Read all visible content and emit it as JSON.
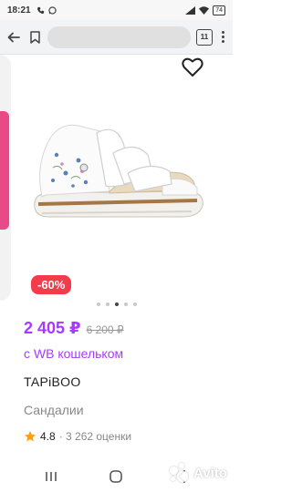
{
  "status_bar": {
    "time": "18:21",
    "battery": "74",
    "icons": [
      "phone-icon",
      "whatsapp-icon",
      "signal-icon",
      "wifi-icon",
      "battery-icon"
    ]
  },
  "browser": {
    "tabs_count": "11",
    "icons": [
      "back-arrow-icon",
      "bookmark-icon",
      "tabs-icon",
      "more-vertical-icon"
    ]
  },
  "product": {
    "discount": "-60%",
    "price": "2 405 ₽",
    "old_price": "6 200 ₽",
    "wallet_text": "с WB кошельком",
    "brand": "TAPiBOO",
    "name": "Сандалии",
    "rating": "4.8",
    "reviews": "· 3 262 оценки",
    "gallery_dots_total": 5,
    "gallery_dots_active": 3,
    "gallery_icons": [
      "heart-icon",
      "star-icon"
    ]
  },
  "watermark": {
    "text": "Avito"
  },
  "nav_bar": {
    "icons": [
      "recent-apps-icon",
      "home-icon",
      "back-icon"
    ]
  },
  "colors": {
    "accent": "#a73afd",
    "discount": "#f23b4b",
    "star": "#ff9f0a"
  }
}
